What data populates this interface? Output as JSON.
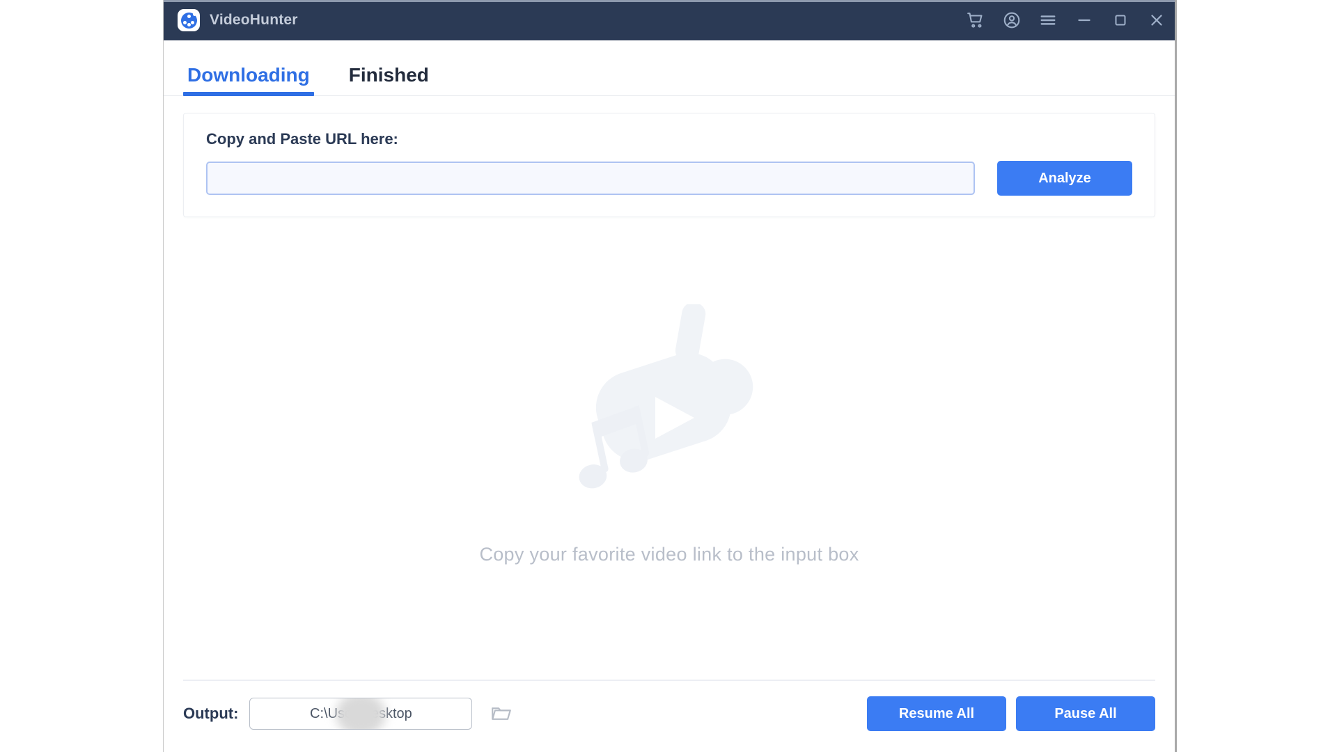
{
  "window": {
    "app_title": "VideoHunter",
    "logo_icon": "videohunter-logo-icon",
    "titlebar_buttons": [
      {
        "name": "cart-icon",
        "label": "Cart"
      },
      {
        "name": "account-icon",
        "label": "Account"
      },
      {
        "name": "menu-icon",
        "label": "Menu"
      },
      {
        "name": "minimize-icon",
        "label": "Minimize"
      },
      {
        "name": "maximize-icon",
        "label": "Maximize"
      },
      {
        "name": "close-icon",
        "label": "Close"
      }
    ],
    "accent_color": "#3b7cf3",
    "titlebar_color": "#2b3a55"
  },
  "tabs": [
    {
      "label": "Downloading",
      "active": true
    },
    {
      "label": "Finished",
      "active": false
    }
  ],
  "url_panel": {
    "label": "Copy and Paste URL here:",
    "input_value": "",
    "input_placeholder": "",
    "analyze_label": "Analyze"
  },
  "empty_state": {
    "hint": "Copy your favorite video link to the input box",
    "watermark_icon": "video-music-watermark-icon"
  },
  "output_bar": {
    "label": "Output:",
    "path_prefix": "C:\\User",
    "path_suffix": "\\Desktop",
    "folder_icon": "open-folder-icon",
    "resume_label": "Resume All",
    "pause_label": "Pause All"
  }
}
